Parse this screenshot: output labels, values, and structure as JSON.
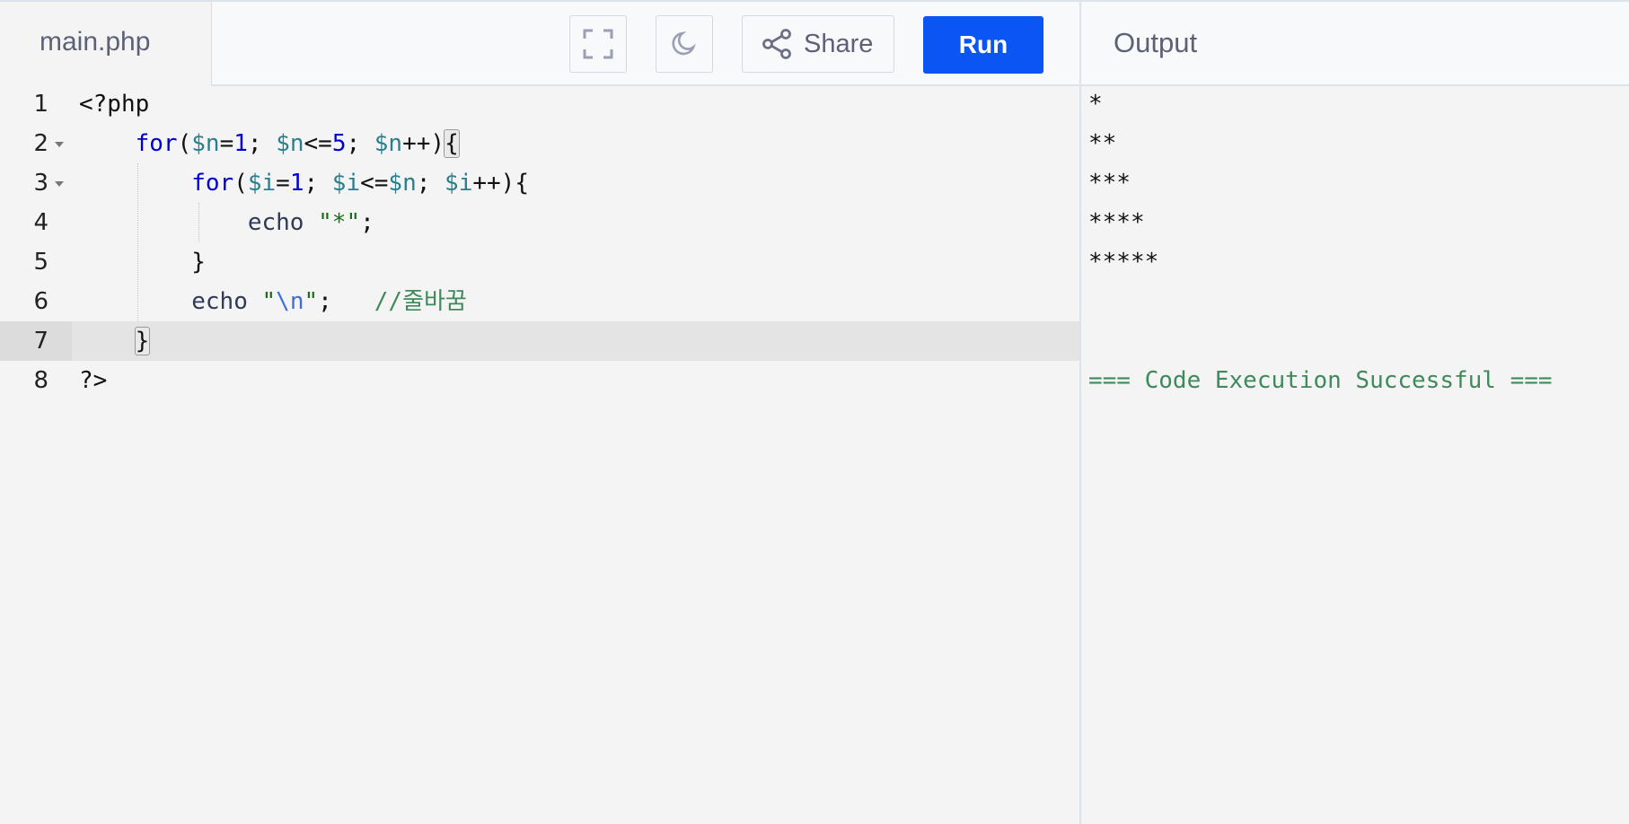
{
  "header": {
    "file_tab": "main.php",
    "share_label": "Share",
    "run_label": "Run",
    "output_title": "Output",
    "icons": [
      "fullscreen-icon",
      "dark-mode-moon-icon",
      "share-icon"
    ]
  },
  "editor": {
    "language": "php",
    "active_line": 7,
    "lines": [
      {
        "num": "1",
        "code": "<?php"
      },
      {
        "num": "2",
        "code": "    for($n=1; $n<=5; $n++){",
        "foldable": true
      },
      {
        "num": "3",
        "code": "        for($i=1; $i<=$n; $i++){",
        "foldable": true
      },
      {
        "num": "4",
        "code": "            echo \"*\";"
      },
      {
        "num": "5",
        "code": "        }"
      },
      {
        "num": "6",
        "code": "        echo \"\\n\";   //줄바꿈"
      },
      {
        "num": "7",
        "code": "    }"
      },
      {
        "num": "8",
        "code": "?>"
      }
    ]
  },
  "output": {
    "lines": [
      "*",
      "**",
      "***",
      "****",
      "*****",
      "",
      "",
      "=== Code Execution Successful ==="
    ]
  },
  "colors": {
    "run_button": "#0b55f4",
    "keyword": "#0000cc",
    "variable": "#2a7f8f",
    "string": "#1a6e1a",
    "comment": "#3e8a5a",
    "success": "#3e8a5a"
  }
}
